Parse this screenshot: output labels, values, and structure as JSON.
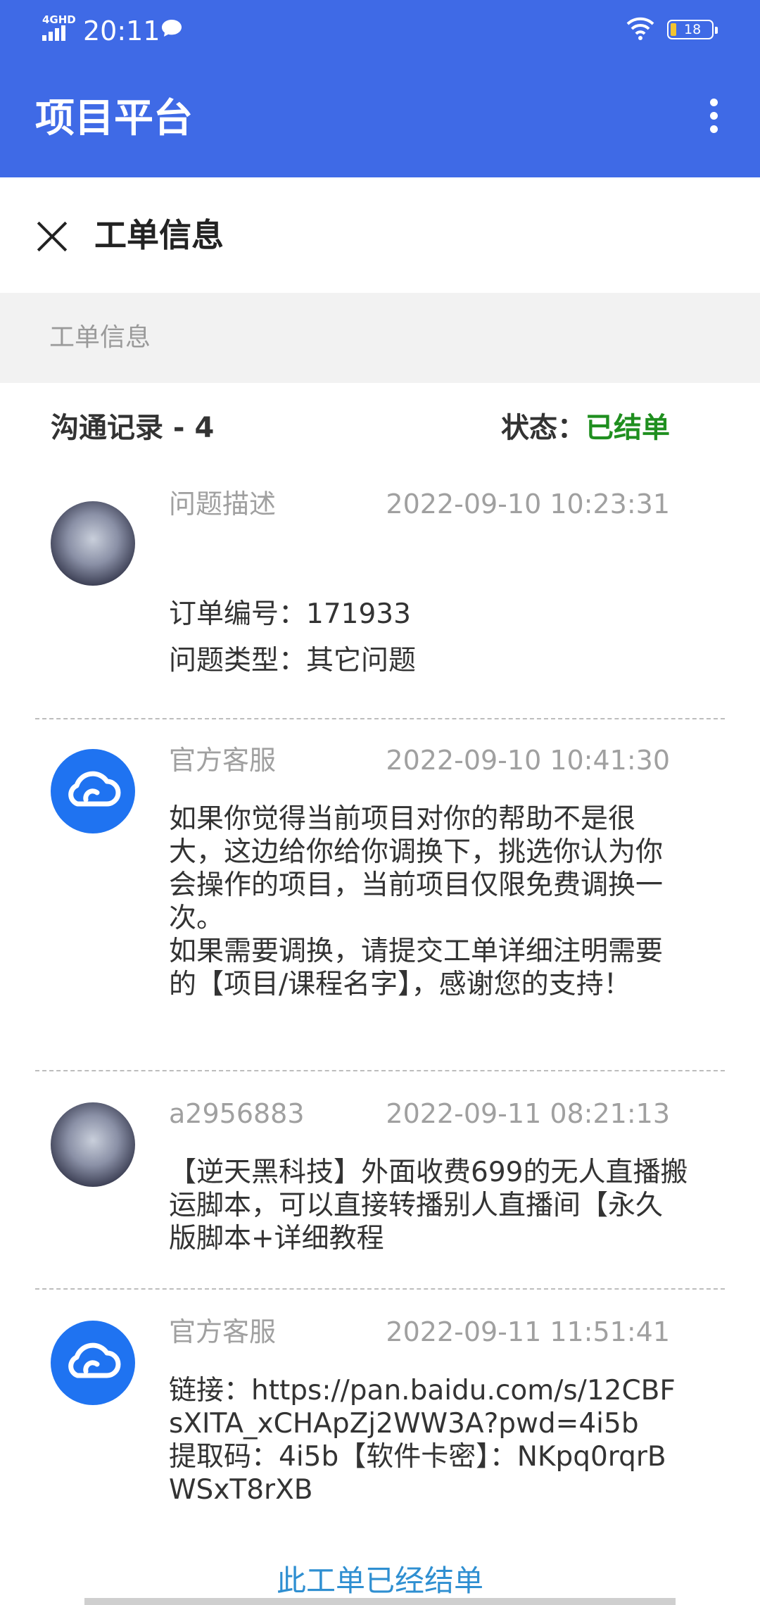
{
  "status_bar": {
    "network": "4GHD",
    "time": "20:11",
    "battery": "18"
  },
  "app_bar": {
    "title": "项目平台"
  },
  "subheader": {
    "title": "工单信息"
  },
  "section": {
    "label": "工单信息"
  },
  "meta": {
    "record_label": "沟通记录 - 4",
    "status_label": "状态：",
    "status_value": "已结单"
  },
  "entries": [
    {
      "name": "问题描述",
      "time": "2022-09-10 10:23:31",
      "body": "订单编号：171933\n问题类型：其它问题",
      "avatar": "user-photo"
    },
    {
      "name": "官方客服",
      "time": "2022-09-10 10:41:30",
      "body": "如果你觉得当前项目对你的帮助不是很大，这边给你给你调换下，挑选你认为你会操作的项目，当前项目仅限免费调换一次。\n如果需要调换，请提交工单详细注明需要的【项目/课程名字】，感谢您的支持！",
      "avatar": "cloud-icon"
    },
    {
      "name": "a2956883",
      "time": "2022-09-11 08:21:13",
      "body": "【逆天黑科技】外面收费699的无人直播搬运脚本，可以直接转播别人直播间【永久版脚本+详细教程",
      "avatar": "user-photo"
    },
    {
      "name": "官方客服",
      "time": "2022-09-11 11:51:41",
      "body": "链接：https://pan.baidu.com/s/12CBFsXITA_xCHApZj2WW3A?pwd=4i5b\n提取码：4i5b【软件卡密】：NKpq0rqrBWSxT8rXB",
      "avatar": "cloud-icon"
    }
  ],
  "footer": {
    "closed_text": "此工单已经结单"
  },
  "colors": {
    "primary": "#3f6ae6",
    "status_done": "#1f8f1f",
    "link": "#2f8fd1",
    "cloud_avatar": "#1f73f1"
  }
}
